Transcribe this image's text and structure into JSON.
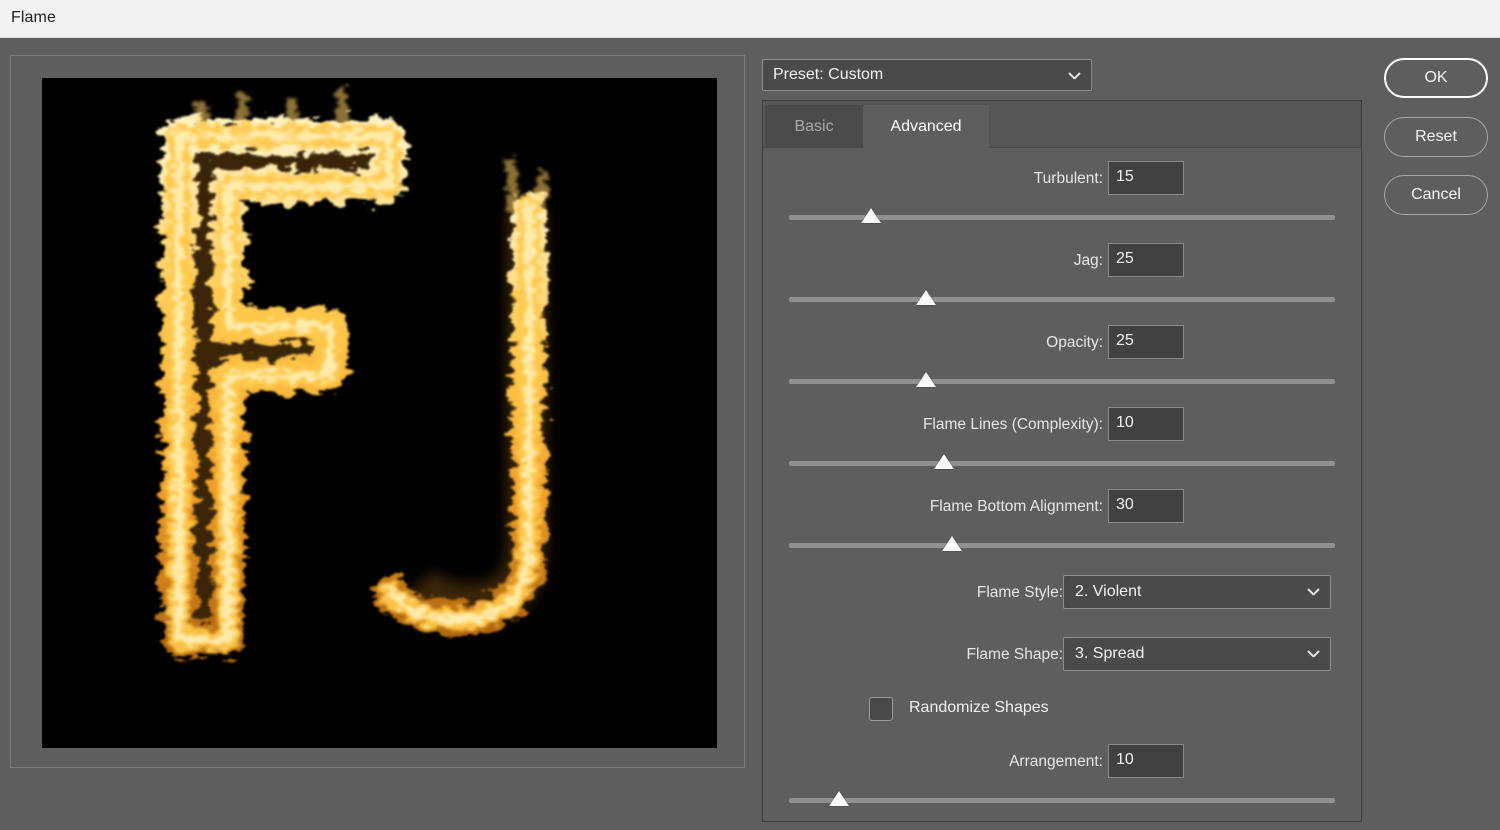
{
  "window": {
    "title": "Flame"
  },
  "preview": {
    "name": "flame-preview",
    "background": "#000000",
    "letters": "FJ",
    "flame_colors": {
      "core": "#fff4c8",
      "mid": "#ffc24a",
      "edge": "#8a5410",
      "dark": "#120c04"
    }
  },
  "preset": {
    "label": "Preset: Custom",
    "icon": "chevron-down-icon"
  },
  "tabs": [
    {
      "id": "basic",
      "label": "Basic",
      "active": false
    },
    {
      "id": "advanced",
      "label": "Advanced",
      "active": true
    }
  ],
  "sliders": [
    {
      "id": "turbulent",
      "label": "Turbulent:",
      "value": "15",
      "percent": 15
    },
    {
      "id": "jag",
      "label": "Jag:",
      "value": "25",
      "percent": 25
    },
    {
      "id": "opacity",
      "label": "Opacity:",
      "value": "25",
      "percent": 25
    },
    {
      "id": "flamelines",
      "label": "Flame Lines (Complexity):",
      "value": "10",
      "percent": 28.5
    },
    {
      "id": "bottomalign",
      "label": "Flame Bottom Alignment:",
      "value": "30",
      "percent": 30
    }
  ],
  "dropdowns": [
    {
      "id": "flame-style",
      "label": "Flame Style:",
      "value": "2. Violent",
      "icon": "chevron-down-icon"
    },
    {
      "id": "flame-shape",
      "label": "Flame Shape:",
      "value": "3. Spread",
      "icon": "chevron-down-icon"
    }
  ],
  "checkbox": {
    "id": "randomize-shapes",
    "label": "Randomize Shapes",
    "checked": false
  },
  "arrangement": {
    "label": "Arrangement:",
    "value": "10",
    "percent": 9.5
  },
  "buttons": [
    {
      "id": "ok",
      "label": "OK",
      "default": true
    },
    {
      "id": "reset",
      "label": "Reset",
      "default": false
    },
    {
      "id": "cancel",
      "label": "Cancel",
      "default": false
    }
  ]
}
